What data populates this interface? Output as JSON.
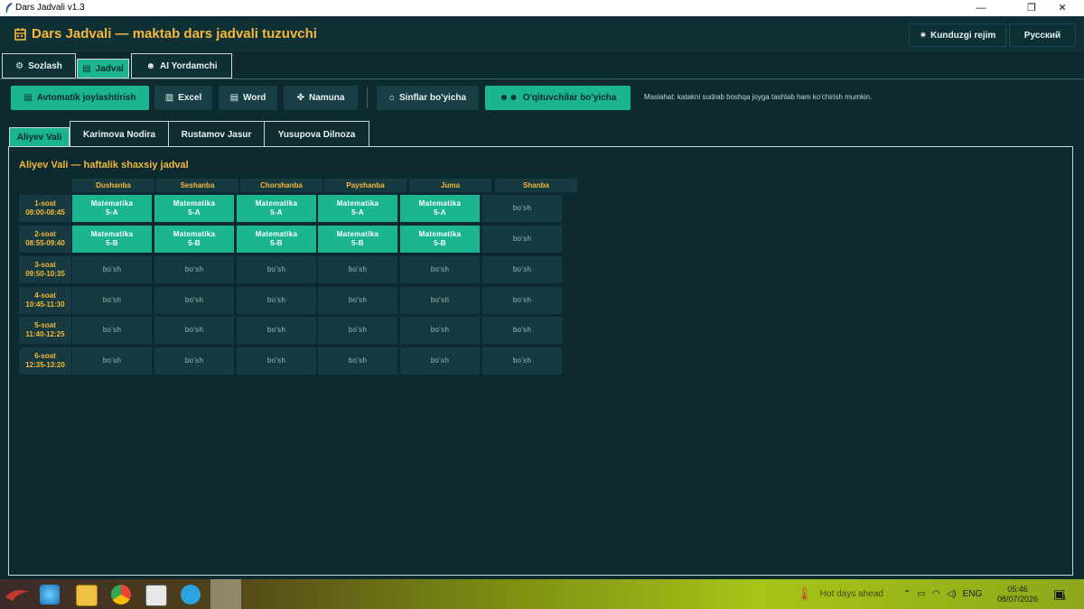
{
  "window": {
    "title": "Dars Jadvali v1.3",
    "minimize": "—",
    "maximize": "❐",
    "close": "✕"
  },
  "header": {
    "app_title": "Dars Jadvali — maktab dars jadvali tuzuvchi",
    "theme_label": "Kunduzgi rejim",
    "language_label": "Русский"
  },
  "main_tabs": [
    {
      "label": "Sozlash"
    },
    {
      "label": "Jadval"
    },
    {
      "label": "AI Yordamchi"
    }
  ],
  "toolbar": {
    "auto_place": "Avtomatik joylashtirish",
    "excel": "Excel",
    "word": "Word",
    "sample": "Namuna",
    "by_classes": "Sinflar bo'yicha",
    "by_teachers": "O'qituvchilar bo'yicha",
    "hint": "Maslahat: katakni sudrab boshqa joyga tashlab ham ko'chirish mumkin."
  },
  "teacher_tabs": [
    {
      "label": "Aliyev Vali"
    },
    {
      "label": "Karimova Nodira"
    },
    {
      "label": "Rustamov Jasur"
    },
    {
      "label": "Yusupova Dilnoza"
    }
  ],
  "schedule": {
    "title": "Aliyev Vali — haftalik shaxsiy jadval",
    "days": [
      "Dushanba",
      "Seshanba",
      "Chorshanba",
      "Payshanba",
      "Juma",
      "Shanba"
    ],
    "periods": [
      {
        "name": "1-soat",
        "time": "08:00-08:45"
      },
      {
        "name": "2-soat",
        "time": "08:55-09:40"
      },
      {
        "name": "3-soat",
        "time": "09:50-10:35"
      },
      {
        "name": "4-soat",
        "time": "10:45-11:30"
      },
      {
        "name": "5-soat",
        "time": "11:40-12:25"
      },
      {
        "name": "6-soat",
        "time": "12:35-13:20"
      }
    ],
    "free_label": "bo'sh",
    "cells": [
      [
        {
          "subject": "Matematika",
          "class": "5-A"
        },
        {
          "subject": "Matematika",
          "class": "5-A"
        },
        {
          "subject": "Matematika",
          "class": "5-A"
        },
        {
          "subject": "Matematika",
          "class": "5-A"
        },
        {
          "subject": "Matematika",
          "class": "5-A"
        },
        null
      ],
      [
        {
          "subject": "Matematika",
          "class": "5-B"
        },
        {
          "subject": "Matematika",
          "class": "5-B"
        },
        {
          "subject": "Matematika",
          "class": "5-B"
        },
        {
          "subject": "Matematika",
          "class": "5-B"
        },
        {
          "subject": "Matematika",
          "class": "5-B"
        },
        null
      ],
      [
        null,
        null,
        null,
        null,
        null,
        null
      ],
      [
        null,
        null,
        null,
        null,
        null,
        null
      ],
      [
        null,
        null,
        null,
        null,
        null,
        null
      ],
      [
        null,
        null,
        null,
        null,
        null,
        null
      ]
    ]
  },
  "taskbar": {
    "weather": "Hot days ahead",
    "language": "ENG",
    "time": "05:46",
    "date": "08/07/2026",
    "notifications": "4"
  },
  "colors": {
    "accent": "#1bb592",
    "title": "#f5b83a",
    "background": "#0c2a2f"
  }
}
